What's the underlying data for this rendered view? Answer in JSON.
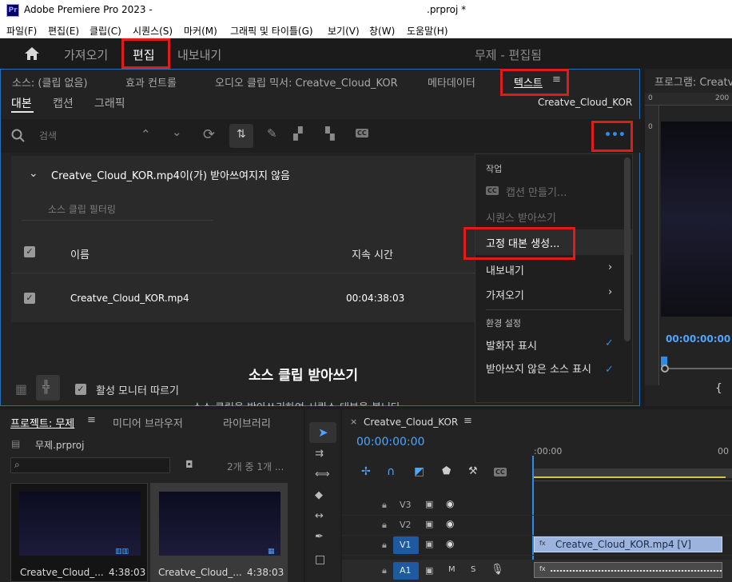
{
  "titlebar": {
    "app_badge": "Pr",
    "title_left": "Adobe Premiere Pro 2023 -",
    "title_right": ".prproj *"
  },
  "menu": [
    "파일(F)",
    "편집(E)",
    "클립(C)",
    "시퀀스(S)",
    "마커(M)",
    "그래픽 및 타이틀(G)",
    "보기(V)",
    "창(W)",
    "도움말(H)"
  ],
  "workspace": {
    "tabs": [
      "가져오기",
      "편집",
      "내보내기"
    ],
    "status": "무제 - 편집됨"
  },
  "text_panel": {
    "tabs": [
      "소스: (클립 없음)",
      "효과 컨트롤",
      "오디오 클립 믹서: Creatve_Cloud_KOR",
      "메타데이터",
      "텍스트"
    ],
    "subtabs": [
      "대본",
      "캡션",
      "그래픽"
    ],
    "sequence_name": "Creatve_Cloud_KOR",
    "search_placeholder": "검색",
    "more_btn": "•••",
    "notice": "Creatve_Cloud_KOR.mp4이(가) 받아쓰여지지 않음",
    "filter_label": "소스 클립 필터링",
    "table_headers": {
      "name": "이름",
      "duration": "지속 시간"
    },
    "rows": [
      {
        "name": "Creatve_Cloud_KOR.mp4",
        "duration": "00:04:38:03"
      }
    ],
    "follow_monitor": "활성 모니터 따르기",
    "big_title": "소스 클립 받아쓰기",
    "desc_cut": "소스 클립을 받아쓰기하여 시퀀스 대본을 봅니다"
  },
  "context_menu": {
    "section_work": "작업",
    "cc_badge": "CC",
    "create_captions": "캡션 만들기...",
    "transcribe_sequence": "시퀀스 받아쓰기",
    "static_transcript": "고정 대본 생성...",
    "export": "내보내기",
    "import": "가져오기",
    "section_prefs": "환경 설정",
    "show_speakers": "발화자 표시",
    "show_untranscribed": "받아쓰지 않은 소스 표시"
  },
  "program": {
    "title": "프로그램: Creatve",
    "timecode": "00:00:00:00",
    "ruler_0": "0",
    "ruler_200": "200",
    "bracket": "{"
  },
  "project_panel": {
    "tabs": [
      "프로젝트: 무제",
      "미디어 브라우저",
      "라이브러리"
    ],
    "file": "무제.prproj",
    "count": "2개 중 1개 ...",
    "items": [
      {
        "name": "Creatve_Cloud_...",
        "duration": "4:38:03"
      },
      {
        "name": "Creatve_Cloud_...",
        "duration": "4:38:03"
      }
    ]
  },
  "timeline": {
    "close": "×",
    "seq_name": "Creatve_Cloud_KOR",
    "timecode": "00:00:00:00",
    "ruler_label": ":00:00",
    "ruler_label_right": "00",
    "tracks": [
      "V3",
      "V2",
      "V1",
      "A1"
    ],
    "clip_label": "Creatve_Cloud_KOR.mp4 [V]",
    "mute": "M",
    "solo": "S"
  },
  "colors": {
    "accent_blue": "#2d8ceb",
    "highlight_red": "#e11a1a",
    "clip_blue": "#9cb4dd"
  }
}
